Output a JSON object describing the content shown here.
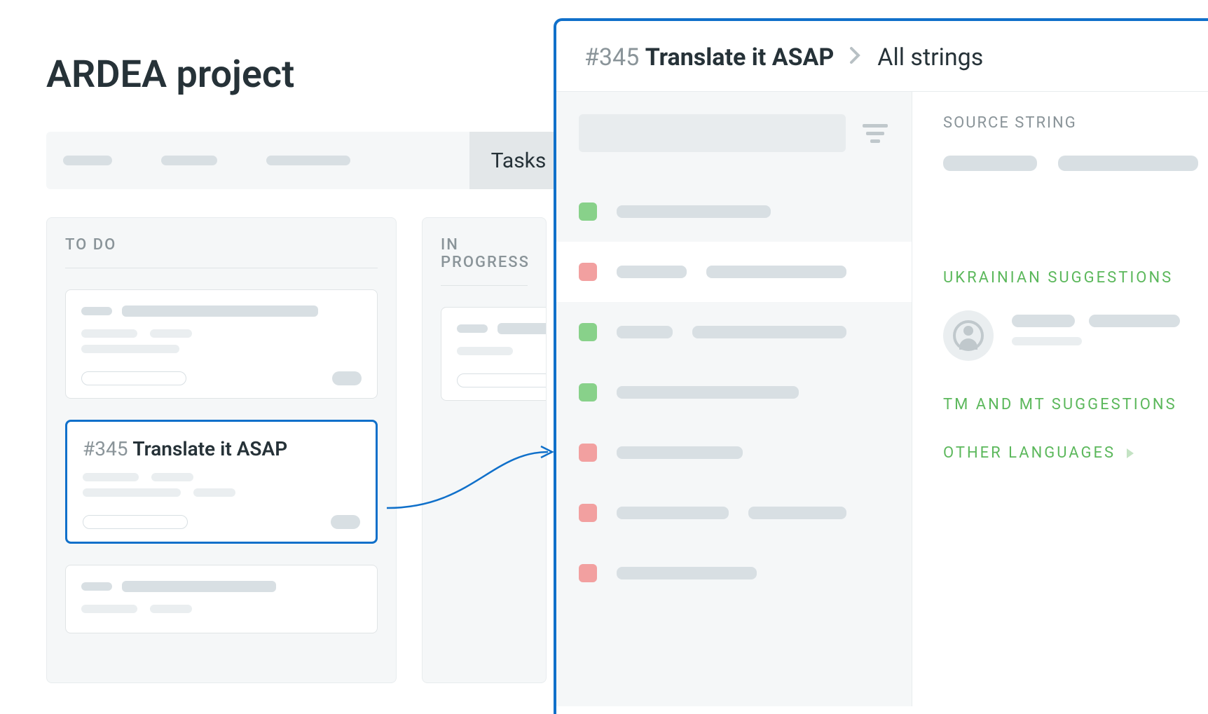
{
  "project": {
    "title": "ARDEA project"
  },
  "tabs": {
    "active_label": "Tasks"
  },
  "kanban": {
    "columns": [
      {
        "header": "TO DO"
      },
      {
        "header": "IN PROGRESS"
      }
    ],
    "selected_card": {
      "id": "#345",
      "title": "Translate it ASAP"
    }
  },
  "editor": {
    "task_id": "#345",
    "task_title": "Translate it ASAP",
    "breadcrumb": "All strings",
    "source_label": "SOURCE STRING",
    "ukrainian_label": "UKRAINIAN SUGGESTIONS",
    "tm_label": "TM AND MT SUGGESTIONS",
    "other_label": "OTHER LANGUAGES"
  },
  "colors": {
    "primary": "#1070ca",
    "green": "#88d18a",
    "red": "#f2a0a0"
  }
}
